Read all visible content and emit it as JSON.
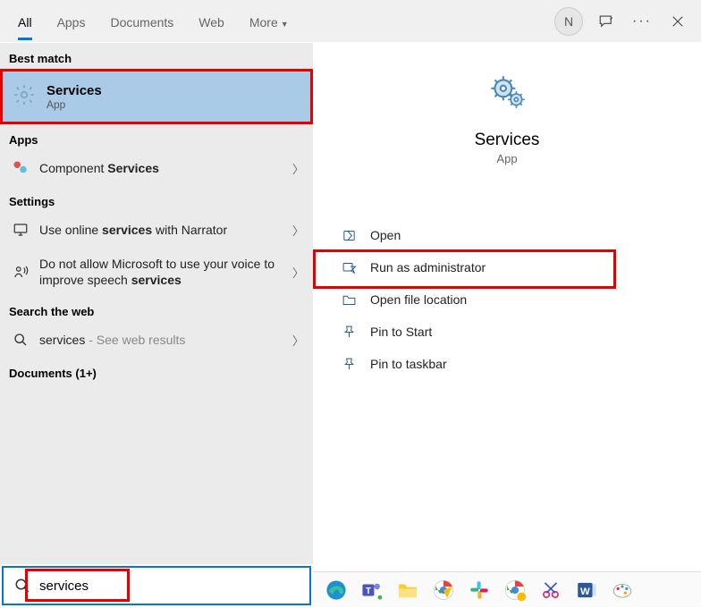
{
  "tabs": {
    "all": "All",
    "apps": "Apps",
    "documents": "Documents",
    "web": "Web",
    "more": "More"
  },
  "avatar_letter": "N",
  "sections": {
    "best": "Best match",
    "apps": "Apps",
    "settings": "Settings",
    "searchweb": "Search the web",
    "documents": "Documents (1+)"
  },
  "bestmatch": {
    "title": "Services",
    "sub": "App"
  },
  "leftApps": {
    "component_pre": "Component ",
    "component_bold": "Services"
  },
  "leftSettings": {
    "s1a": "Use online ",
    "s1b": "services",
    "s1c": " with Narrator",
    "s2a": "Do not allow Microsoft to use your voice to improve speech ",
    "s2b": "services"
  },
  "leftWeb": {
    "label": "services",
    "hint": " - See web results"
  },
  "preview": {
    "title": "Services",
    "sub": "App"
  },
  "actions": {
    "open": "Open",
    "runadmin": "Run as administrator",
    "openloc": "Open file location",
    "pinstart": "Pin to Start",
    "pintaskbar": "Pin to taskbar"
  },
  "search_value": "services"
}
